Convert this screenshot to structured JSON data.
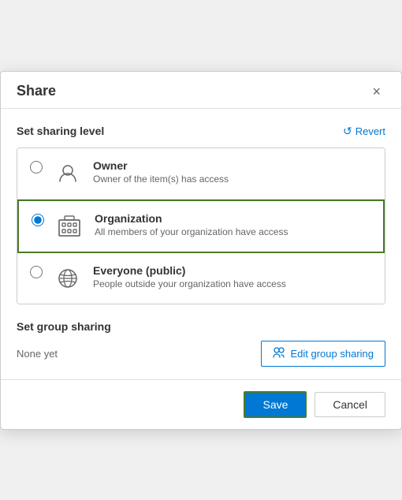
{
  "dialog": {
    "title": "Share",
    "close_label": "×"
  },
  "sharing_level": {
    "section_title": "Set sharing level",
    "revert_label": "Revert",
    "options": [
      {
        "id": "owner",
        "label": "Owner",
        "description": "Owner of the item(s) has access",
        "selected": false
      },
      {
        "id": "organization",
        "label": "Organization",
        "description": "All members of your organization have access",
        "selected": true
      },
      {
        "id": "everyone",
        "label": "Everyone (public)",
        "description": "People outside your organization have access",
        "selected": false
      }
    ]
  },
  "group_sharing": {
    "section_title": "Set group sharing",
    "none_yet": "None yet",
    "edit_button_label": "Edit group sharing"
  },
  "footer": {
    "save_label": "Save",
    "cancel_label": "Cancel"
  }
}
